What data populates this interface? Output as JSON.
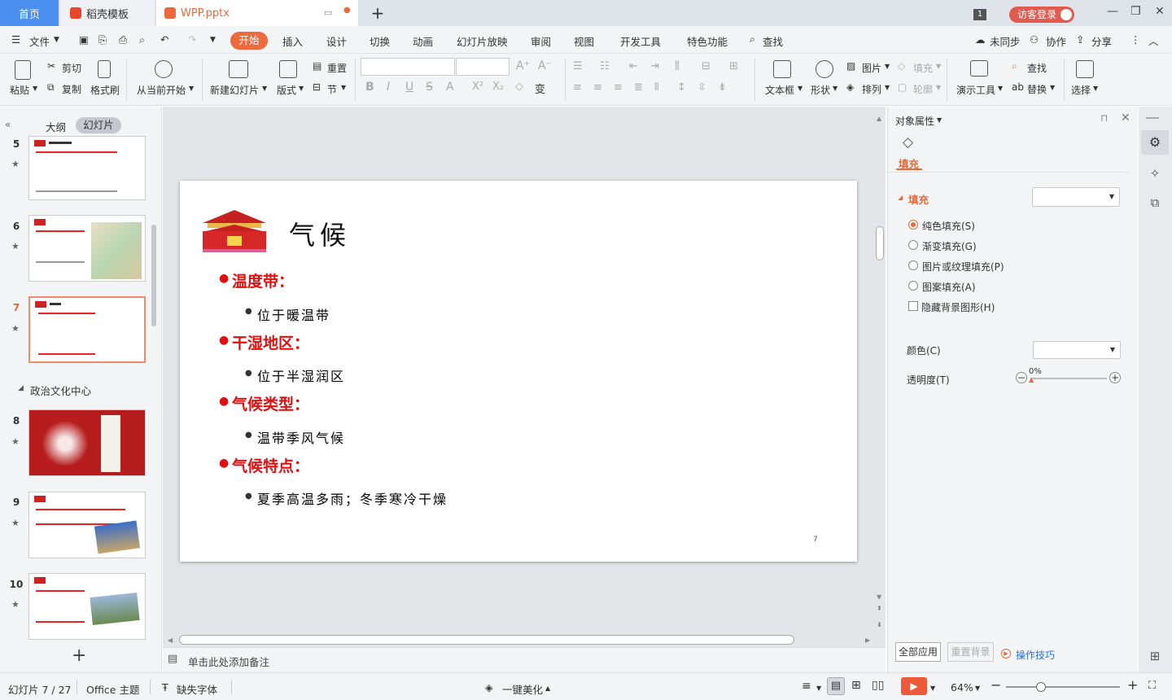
{
  "tabs": {
    "home": "首页",
    "template": "稻壳模板",
    "doc": "WPP.pptx",
    "login": "访客登录",
    "badge": "1"
  },
  "menu": {
    "file": "文件",
    "items": [
      "开始",
      "插入",
      "设计",
      "切换",
      "动画",
      "幻灯片放映",
      "审阅",
      "视图",
      "开发工具",
      "特色功能"
    ],
    "search": "查找",
    "unsync": "未同步",
    "collab": "协作",
    "share": "分享"
  },
  "ribbon": {
    "paste": "粘贴",
    "cut": "剪切",
    "copy": "复制",
    "format_painter": "格式刷",
    "from_current": "从当前开始",
    "new_slide": "新建幻灯片",
    "layout": "版式",
    "reset": "重置",
    "section": "节",
    "textbox": "文本框",
    "shape": "形状",
    "picture": "图片",
    "arrange": "排列",
    "fill": "填充",
    "outline": "轮廓",
    "present_tools": "演示工具",
    "find": "查找",
    "replace": "替换",
    "select": "选择"
  },
  "left_panel": {
    "outline_tab": "大纲",
    "slides_tab": "幻灯片",
    "section_name": "政治文化中心",
    "slide_numbers": [
      "5",
      "6",
      "7",
      "8",
      "9",
      "10"
    ]
  },
  "slide": {
    "title": "气候",
    "page_number": "7",
    "bullets": [
      {
        "heading": "温度带：",
        "detail": "位于暖温带"
      },
      {
        "heading": "干湿地区：",
        "detail": "位于半湿润区"
      },
      {
        "heading": "气候类型：",
        "detail": "温带季风气候"
      },
      {
        "heading": "气候特点：",
        "detail": "夏季高温多雨；冬季寒冷干燥"
      }
    ]
  },
  "properties": {
    "title": "对象属性",
    "tab_fill": "填充",
    "section_fill": "填充",
    "options": [
      "纯色填充(S)",
      "渐变填充(G)",
      "图片或纹理填充(P)",
      "图案填充(A)"
    ],
    "hide_bg": "隐藏背景图形(H)",
    "color_label": "颜色(C)",
    "transparency_label": "透明度(T)",
    "transparency_value": "0%",
    "apply_all": "全部应用",
    "reset_bg": "重置背景",
    "tips": "操作技巧"
  },
  "notes_placeholder": "单击此处添加备注",
  "status": {
    "slide_count": "幻灯片 7 / 27",
    "theme": "Office 主题",
    "missing_font": "缺失字体",
    "beautify": "一键美化",
    "zoom": "64%"
  },
  "colors": {
    "accent": "#ec6a3c",
    "tab_home": "#4a8ff0",
    "bullet_red": "#e01010"
  }
}
